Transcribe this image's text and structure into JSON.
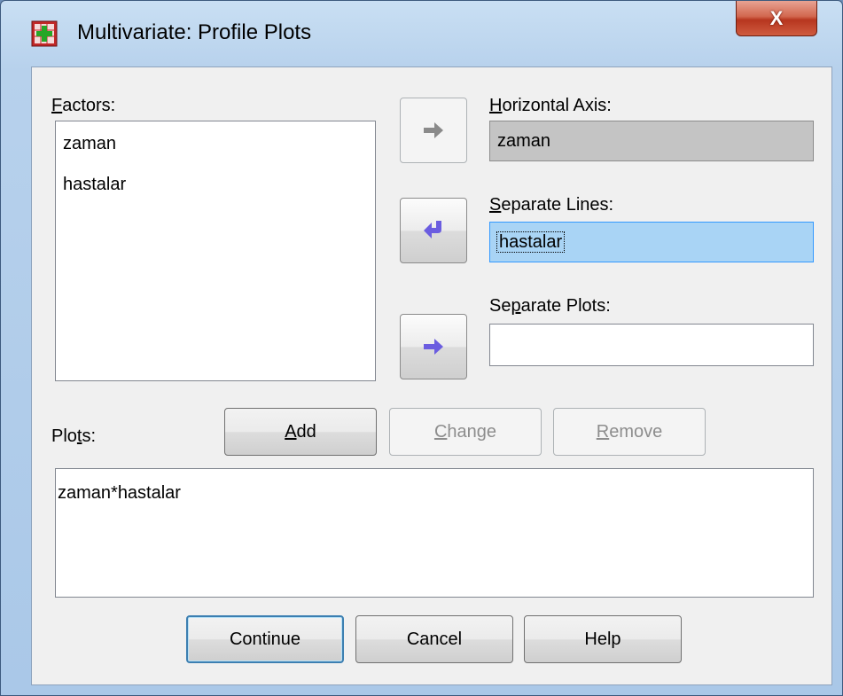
{
  "window": {
    "title": "Multivariate: Profile Plots",
    "close_label": "X"
  },
  "factors": {
    "label_accel": "F",
    "label_rest": "actors:",
    "items": [
      "zaman",
      "hastalar"
    ]
  },
  "horizontal_axis": {
    "label_accel": "H",
    "label_rest": "orizontal Axis:",
    "value": "zaman"
  },
  "separate_lines": {
    "label_accel": "S",
    "label_rest": "eparate Lines:",
    "value": "hastalar"
  },
  "separate_plots": {
    "label_pre": "Se",
    "label_accel": "p",
    "label_rest": "arate Plots:",
    "value": ""
  },
  "plots": {
    "label_pre": "Plo",
    "label_accel": "t",
    "label_rest": "s:",
    "add_accel": "A",
    "add_rest": "dd",
    "change_accel": "C",
    "change_rest": "hange",
    "remove_accel": "R",
    "remove_rest": "emove",
    "items": [
      "zaman*hastalar"
    ]
  },
  "footer": {
    "continue_label": "Continue",
    "cancel_label": "Cancel",
    "help_label": "Help"
  },
  "colors": {
    "selection_bg": "#a9d4f5",
    "selection_border": "#3399ff",
    "disabled_field_bg": "#c4c4c4",
    "arrow_active": "#6b5de0",
    "arrow_disabled": "#8a8a8a"
  }
}
